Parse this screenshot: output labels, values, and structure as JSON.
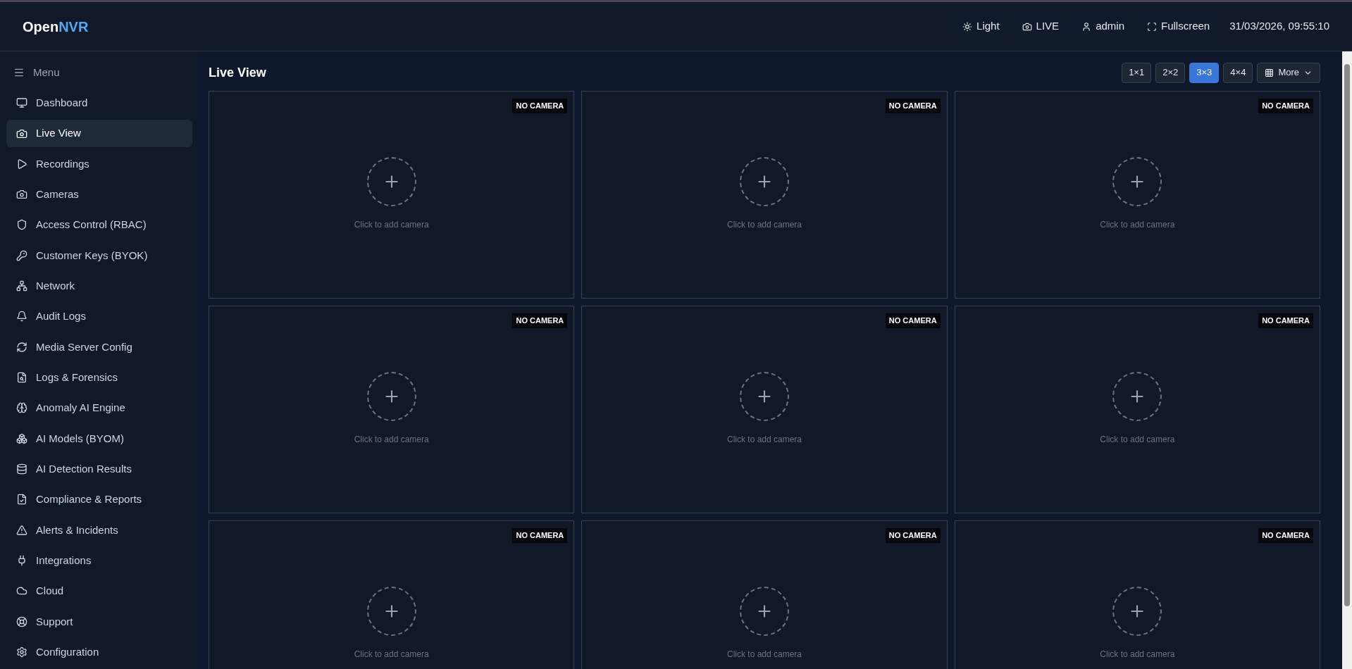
{
  "header": {
    "logo": {
      "part_1": "Open",
      "part_2": "NVR"
    },
    "actions": [
      "Light",
      "LIVE",
      "admin",
      "Fullscreen"
    ],
    "datetime": "31/03/2026, 09:55:10"
  },
  "sidebar": {
    "menu_label": "Menu",
    "items": [
      {
        "label": "Dashboard",
        "selected": false
      },
      {
        "label": "Live View",
        "selected": true
      },
      {
        "label": "Recordings",
        "selected": false
      },
      {
        "label": "Cameras",
        "selected": false
      },
      {
        "label": "Access Control (RBAC)",
        "selected": false
      },
      {
        "label": "Customer Keys (BYOK)",
        "selected": false
      },
      {
        "label": "Network",
        "selected": false
      },
      {
        "label": "Audit Logs",
        "selected": false
      },
      {
        "label": "Media Server Config",
        "selected": false
      },
      {
        "label": "Logs & Forensics",
        "selected": false
      },
      {
        "label": "Anomaly AI Engine",
        "selected": false
      },
      {
        "label": "AI Models (BYOM)",
        "selected": false
      },
      {
        "label": "AI Detection Results",
        "selected": false
      },
      {
        "label": "Compliance & Reports",
        "selected": false
      },
      {
        "label": "Alerts & Incidents",
        "selected": false
      },
      {
        "label": "Integrations",
        "selected": false
      },
      {
        "label": "Cloud",
        "selected": false
      },
      {
        "label": "Support",
        "selected": false
      },
      {
        "label": "Configuration",
        "selected": false
      }
    ]
  },
  "page_title": "Live View",
  "layouts": [
    {
      "label": "1×1",
      "selected": false
    },
    {
      "label": "2×2",
      "selected": false
    },
    {
      "label": "3×3",
      "selected": true
    },
    {
      "label": "4×4",
      "selected": false
    }
  ],
  "more_button": "More",
  "tiles": [
    {
      "badge": "NO CAMERA",
      "hint": "Click to add camera"
    },
    {
      "badge": "NO CAMERA",
      "hint": "Click to add camera"
    },
    {
      "badge": "NO CAMERA",
      "hint": "Click to add camera"
    },
    {
      "badge": "NO CAMERA",
      "hint": "Click to add camera"
    },
    {
      "badge": "NO CAMERA",
      "hint": "Click to add camera"
    },
    {
      "badge": "NO CAMERA",
      "hint": "Click to add camera"
    },
    {
      "badge": "NO CAMERA",
      "hint": "Click to add camera"
    },
    {
      "badge": "NO CAMERA",
      "hint": "Click to add camera"
    },
    {
      "badge": "NO CAMERA",
      "hint": "Click to add camera"
    }
  ]
}
